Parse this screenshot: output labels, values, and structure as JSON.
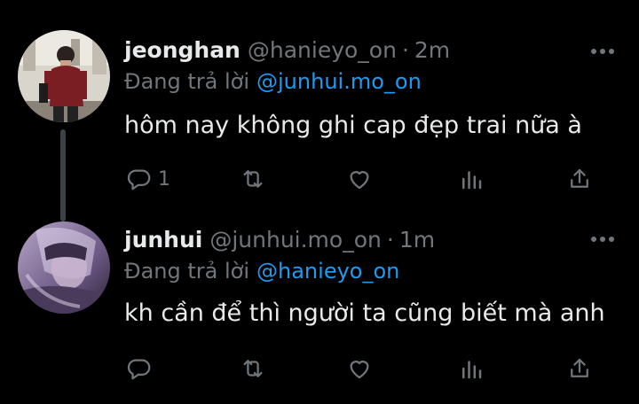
{
  "tweets": [
    {
      "name": "jeonghan",
      "handle": "@hanieyo_on",
      "separator": "·",
      "time": "2m",
      "reply_prefix": "Đang trả lời",
      "reply_to": "@junhui.mo_on",
      "text": "hôm nay không ghi cap đẹp trai nữa à",
      "reply_count": "1",
      "avatar_icon": "avatar-photo-person-red-shirt"
    },
    {
      "name": "junhui",
      "handle": "@junhui.mo_on",
      "separator": "·",
      "time": "1m",
      "reply_prefix": "Đang trả lời",
      "reply_to": "@hanieyo_on",
      "text": "kh cần để thì người ta cũng biết mà anh",
      "reply_count": "",
      "avatar_icon": "avatar-photo-purple-portrait"
    }
  ],
  "icons": {
    "reply": "reply-icon",
    "retweet": "retweet-icon",
    "like": "heart-icon",
    "views": "analytics-icon",
    "share": "share-icon",
    "more": "more-icon"
  },
  "colors": {
    "background": "#000000",
    "primary_text": "#e7e9ea",
    "secondary_text": "#71767b",
    "mention": "#1d9bf0",
    "thread_line": "#3e4144"
  }
}
